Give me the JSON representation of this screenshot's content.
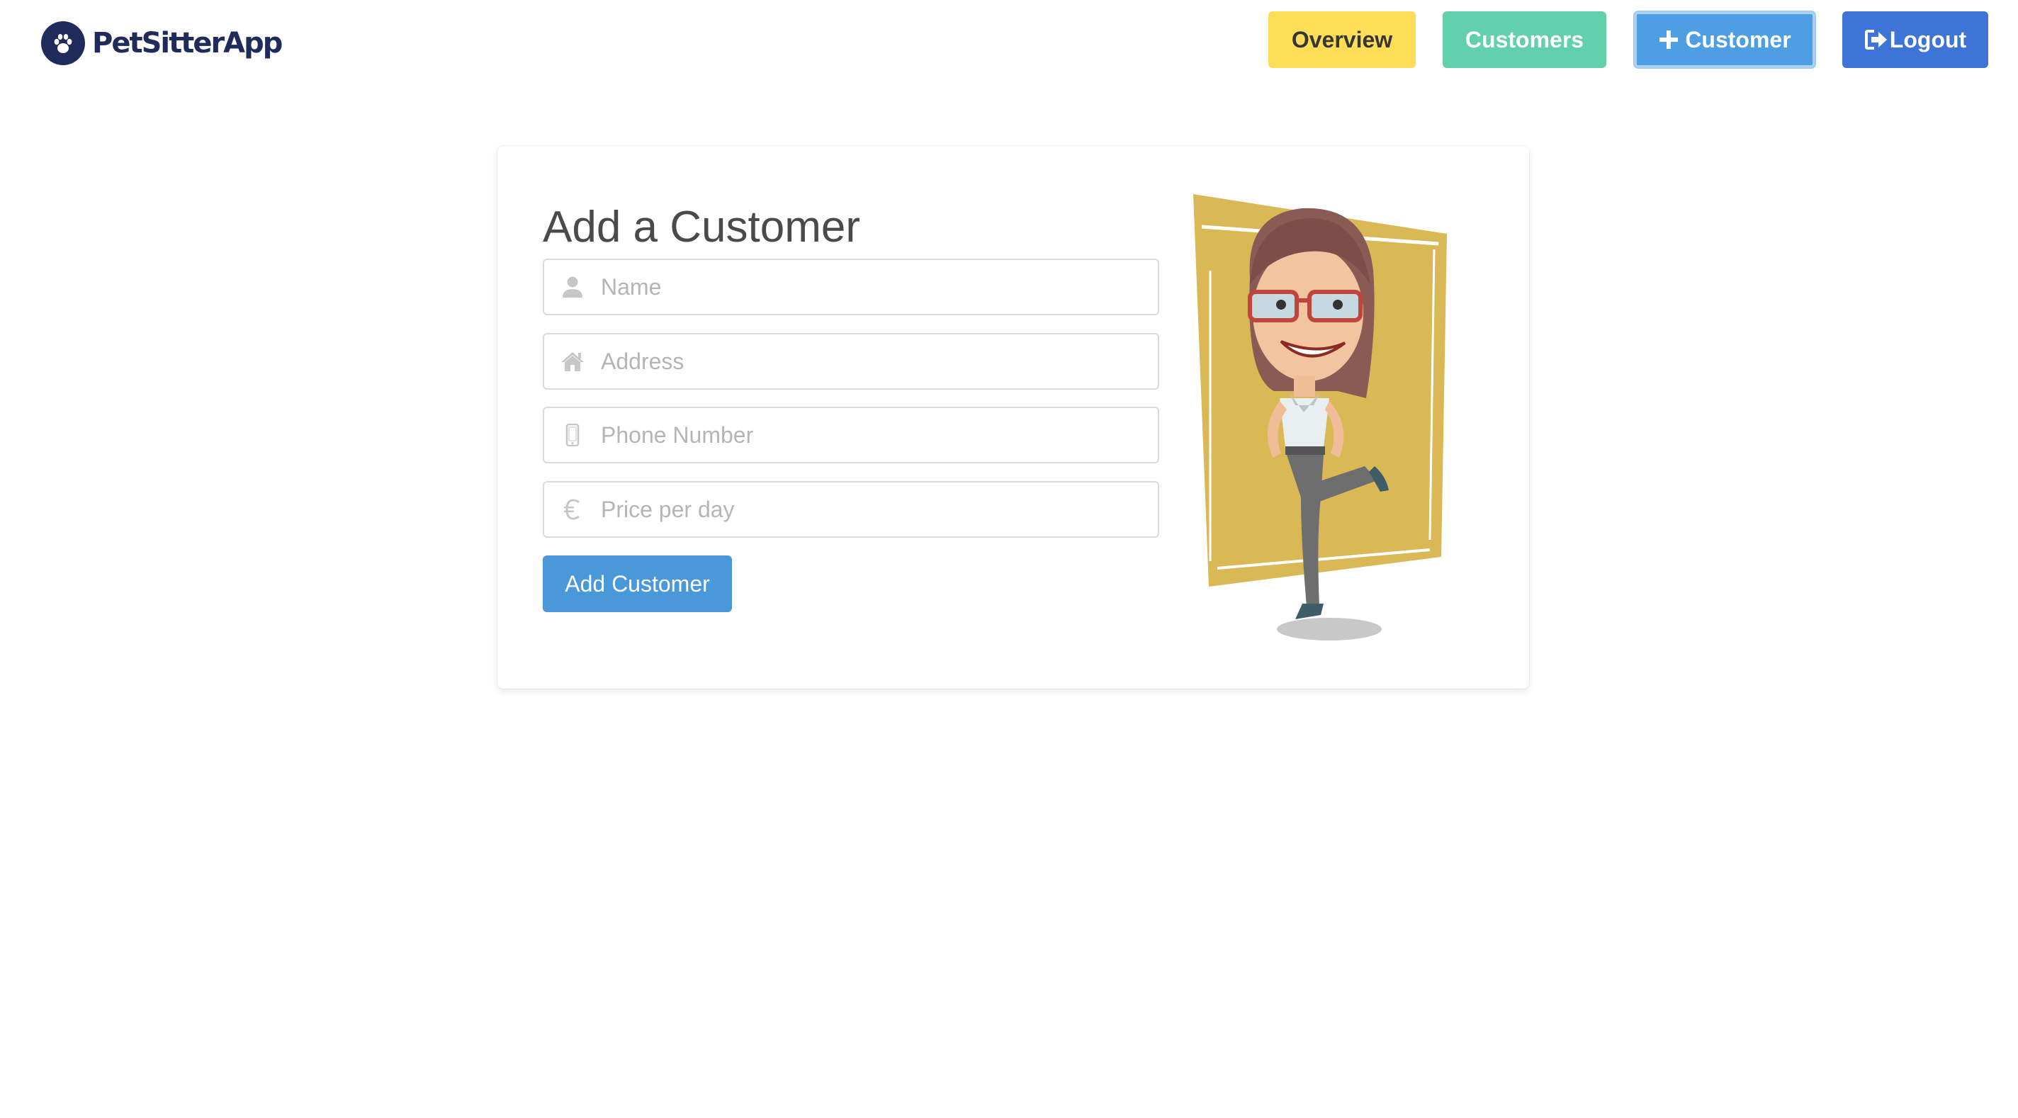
{
  "brand": {
    "name": "PetSitterApp"
  },
  "nav": {
    "overview_label": "Overview",
    "customers_label": "Customers",
    "add_customer_label": "Customer",
    "logout_label": "Logout"
  },
  "form": {
    "title": "Add a Customer",
    "fields": {
      "name": {
        "placeholder": "Name",
        "value": "",
        "icon": "user-icon"
      },
      "address": {
        "placeholder": "Address",
        "value": "",
        "icon": "home-icon"
      },
      "phone": {
        "placeholder": "Phone Number",
        "value": "",
        "icon": "mobile-icon"
      },
      "price": {
        "placeholder": "Price per day",
        "value": "",
        "icon": "euro-icon"
      }
    },
    "submit_label": "Add Customer"
  },
  "colors": {
    "overview": "#ffdd57",
    "customers": "#62d0ad",
    "add_customer": "#4d9ee3",
    "logout": "#3d74d6",
    "brand": "#1f2b5a",
    "illustration_backdrop": "#d9b855"
  }
}
